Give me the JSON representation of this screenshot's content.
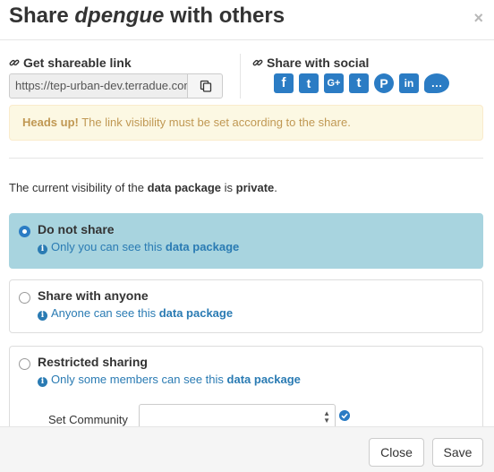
{
  "modal": {
    "title_prefix": "Share ",
    "title_item": "dpengue",
    "title_suffix": " with others",
    "close_glyph": "×"
  },
  "share_link": {
    "label": "Get shareable link",
    "url_value": "https://tep-urban-dev.terradue.com/",
    "copy_icon": "clipboard-icon"
  },
  "social": {
    "label": "Share with social",
    "networks": [
      {
        "name": "facebook",
        "glyph": "f"
      },
      {
        "name": "twitter",
        "glyph": "t"
      },
      {
        "name": "google-plus",
        "glyph": "G+"
      },
      {
        "name": "tumblr",
        "glyph": "t"
      },
      {
        "name": "pinterest",
        "glyph": "P"
      },
      {
        "name": "linkedin",
        "glyph": "in"
      },
      {
        "name": "comments",
        "glyph": "…"
      }
    ]
  },
  "alert": {
    "strong": "Heads up!",
    "text": " The link visibility must be set according to the share."
  },
  "visibility": {
    "prefix": "The current visibility of the ",
    "entity": "data package",
    "middle": " is ",
    "state": "private",
    "suffix": "."
  },
  "options": [
    {
      "label": "Do not share",
      "note_prefix": "Only you can see this ",
      "note_entity": "data package",
      "selected": true
    },
    {
      "label": "Share with anyone",
      "note_prefix": "Anyone can see this ",
      "note_entity": "data package",
      "selected": false
    },
    {
      "label": "Restricted sharing",
      "note_prefix": "Only some members can see this ",
      "note_entity": "data package",
      "selected": false
    }
  ],
  "restricted": {
    "community_label": "Set Community",
    "community_value": ""
  },
  "footer": {
    "close_label": "Close",
    "save_label": "Save"
  },
  "colors": {
    "accent": "#2b7cc4",
    "selected_option_bg": "#a8d4df",
    "alert_bg": "#fcf8e3",
    "alert_text": "#c09853"
  }
}
